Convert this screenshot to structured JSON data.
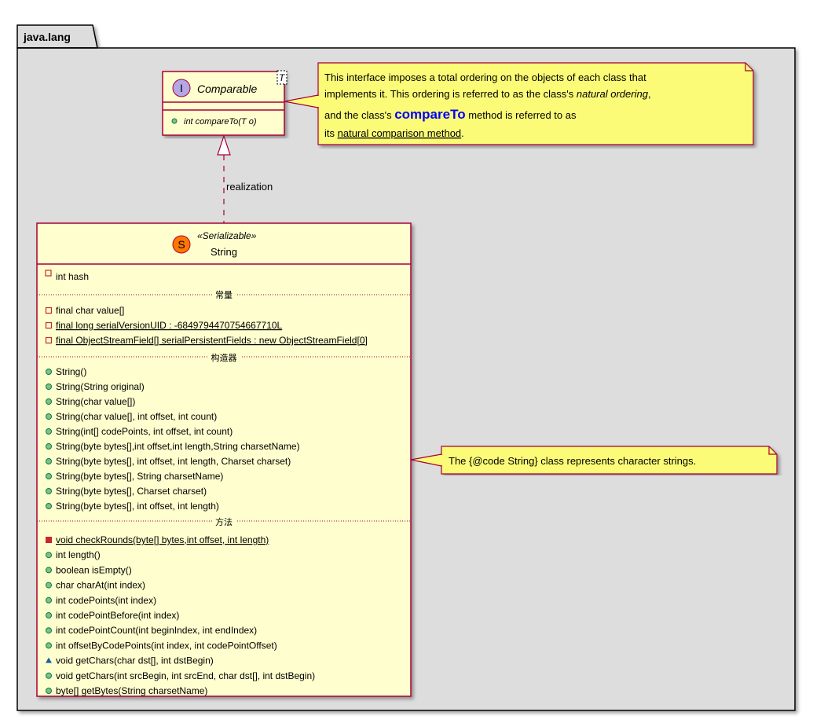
{
  "package": {
    "name": "java.lang"
  },
  "interface": {
    "stereotype_letter": "I",
    "name": "Comparable",
    "generic_param": "T",
    "method": "int compareTo(T o)"
  },
  "relation": {
    "label": "realization"
  },
  "note_interface": {
    "line1": "This interface imposes a total ordering on the objects of each class that",
    "line2_prefix": "implements it.  This ordering is referred to as the class's ",
    "line2_italic": "natural ordering",
    "line2_suffix": ",",
    "line3_prefix": "and the class's ",
    "line3_code": "compareTo",
    "line3_suffix": " method is referred to as",
    "line4_prefix": "its ",
    "line4_underlined": "natural comparison method",
    "line4_suffix": "."
  },
  "note_class": {
    "text": "The {@code String} class represents character strings."
  },
  "class": {
    "stereotype_letter": "S",
    "stereotype": "«Serializable»",
    "name": "String",
    "field_hash": "int hash",
    "section_constants": "常量",
    "constants": [
      "final char value[]",
      "final long serialVersionUID : -6849794470754667710L",
      "final ObjectStreamField[] serialPersistentFields : new ObjectStreamField[0]"
    ],
    "section_constructors": "构造器",
    "constructors": [
      "String()",
      "String(String original)",
      "String(char value[])",
      "String(char value[], int offset, int count)",
      "String(int[] codePoints, int offset, int count)",
      "String(byte bytes[],int offset,int length,String charsetName)",
      "String(byte bytes[], int offset, int length, Charset charset)",
      "String(byte bytes[], String charsetName)",
      "String(byte bytes[], Charset charset)",
      "String(byte bytes[], int offset, int length)"
    ],
    "section_methods": "方法",
    "methods": [
      "void checkRounds(byte[] bytes,int offset, int length)",
      "int length()",
      "boolean isEmpty()",
      "char charAt(int index)",
      "int codePoints(int index)",
      "int codePointBefore(int index)",
      "int codePointCount(int beginIndex, int endIndex)",
      "int offsetByCodePoints(int index, int codePointOffset)",
      "void getChars(char dst[], int dstBegin)",
      "void getChars(int srcBegin, int srcEnd, char dst[], int dstBegin)",
      "byte[] getBytes(String charsetName)"
    ]
  },
  "colors": {
    "package_bg": "#dddddd",
    "class_bg": "#fefece",
    "border": "#a80036",
    "note_bg": "#fbfb77",
    "interface_circle": "#b4a7e5",
    "class_circle": "#ff7700",
    "public_dot": "#84be84",
    "private_square": "#c82930",
    "package_tri": "#1963a0",
    "code_blue": "#0000ff"
  }
}
